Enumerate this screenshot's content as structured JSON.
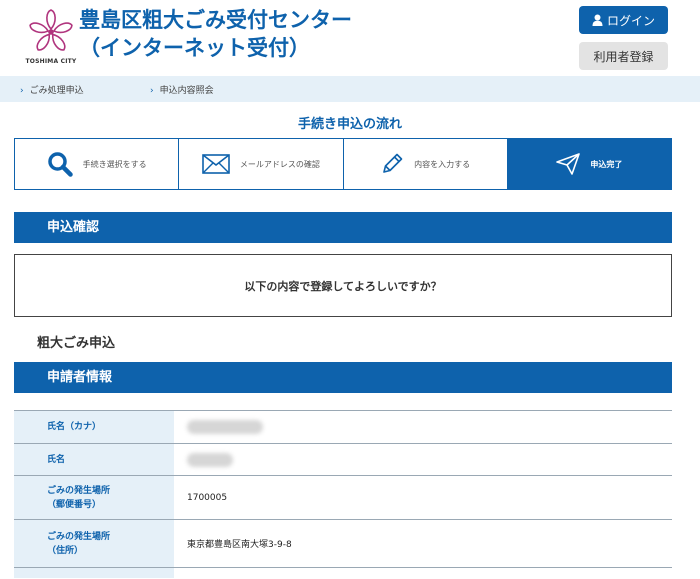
{
  "header": {
    "title_line1": "豊島区粗大ごみ受付センター",
    "title_line2": "（インターネット受付）",
    "logo_caption": "TOSHIMA CITY",
    "login_label": "ログイン",
    "register_label": "利用者登録"
  },
  "breadcrumb": {
    "items": [
      {
        "label": "ごみ処理申込"
      },
      {
        "label": "申込内容照会"
      }
    ]
  },
  "flow": {
    "title": "手続き申込の流れ",
    "steps": [
      {
        "label": "手続き選択をする",
        "icon": "search-icon"
      },
      {
        "label": "メールアドレスの確認",
        "icon": "mail-icon"
      },
      {
        "label": "内容を入力する",
        "icon": "pencil-icon"
      },
      {
        "label": "申込完了",
        "icon": "paper-plane-icon"
      }
    ],
    "active_index": 3
  },
  "confirm": {
    "section_title": "申込確認",
    "message": "以下の内容で登録してよろしいですか？"
  },
  "application": {
    "title": "粗大ごみ申込",
    "applicant_section": "申請者情報",
    "rows": [
      {
        "label_line1": "氏名（カナ）",
        "label_line2": "",
        "value": ""
      },
      {
        "label_line1": "氏名",
        "label_line2": "",
        "value": ""
      },
      {
        "label_line1": "ごみの発生場所",
        "label_line2": "（郵便番号）",
        "value": "1700005"
      },
      {
        "label_line1": "ごみの発生場所",
        "label_line2": "（住所）",
        "value": "東京都豊島区南大塚3-9-8"
      }
    ]
  },
  "colors": {
    "primary": "#0e62ac",
    "light": "#e5f0f8"
  }
}
